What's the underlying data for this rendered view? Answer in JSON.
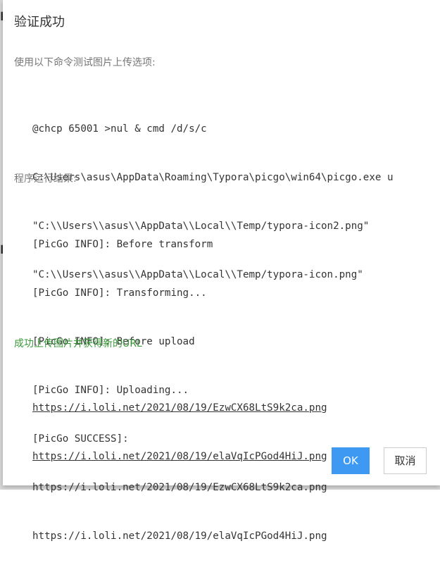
{
  "dialog": {
    "title": "验证成功",
    "test_label": "使用以下命令测试图片上传选项:",
    "command_lines": [
      "@chcp 65001 >nul & cmd /d/s/c",
      "C:\\Users\\asus\\AppData\\Roaming\\Typora\\picgo\\win64\\picgo.exe u",
      "\"C:\\\\Users\\\\asus\\\\AppData\\\\Local\\\\Temp/typora-icon2.png\"",
      "\"C:\\\\Users\\\\asus\\\\AppData\\\\Local\\\\Temp/typora-icon.png\""
    ],
    "result_label": "程序运行结果:",
    "output_lines": [
      "[PicGo INFO]: Before transform",
      "[PicGo INFO]: Transforming...",
      "[PicGo INFO]: Before upload",
      "[PicGo INFO]: Uploading...",
      "[PicGo SUCCESS]:",
      "https://i.loli.net/2021/08/19/EzwCX68LtS9k2ca.png",
      "https://i.loli.net/2021/08/19/elaVqIcPGod4HiJ.png"
    ],
    "success_label": "成功上传图片并获得新的URL",
    "urls": [
      "https://i.loli.net/2021/08/19/EzwCX68LtS9k2ca.png",
      "https://i.loli.net/2021/08/19/elaVqIcPGod4HiJ.png"
    ],
    "ok_label": "OK",
    "cancel_label": "取消"
  },
  "colors": {
    "primary": "#3d99f2",
    "success_text": "#3a9a3a"
  }
}
